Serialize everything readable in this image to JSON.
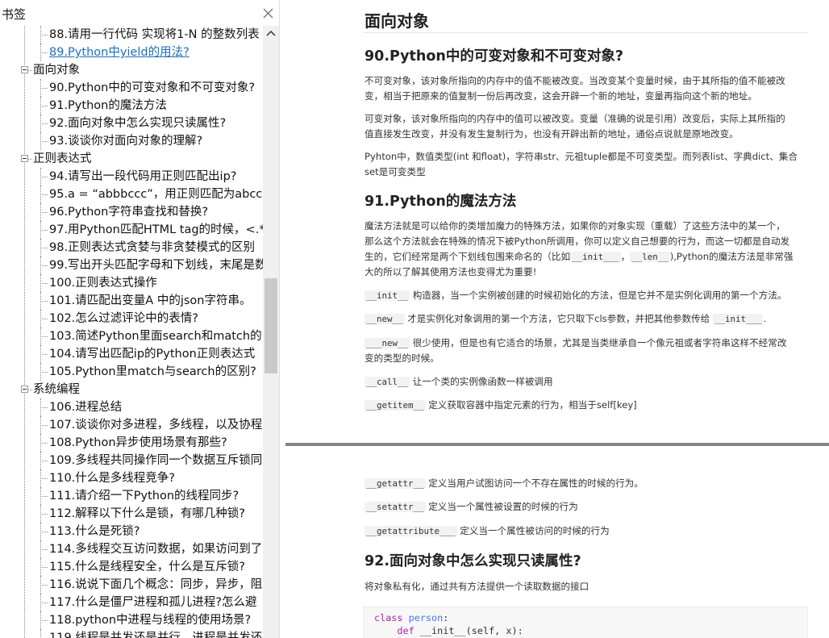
{
  "bookmarks": {
    "title": "书签",
    "items": [
      {
        "label": "88.请用一行代码 实现将1-N 的整数列表",
        "level": 1
      },
      {
        "label": "89.Python中yield的用法?",
        "level": 1,
        "link": true
      },
      {
        "label": "面向对象",
        "level": 0
      },
      {
        "label": "90.Python中的可变对象和不可变对象?",
        "level": 1
      },
      {
        "label": "91.Python的魔法方法",
        "level": 1
      },
      {
        "label": "92.面向对象中怎么实现只读属性?",
        "level": 1
      },
      {
        "label": "93.谈谈你对面向对象的理解?",
        "level": 1
      },
      {
        "label": "正则表达式",
        "level": 0
      },
      {
        "label": "94.请写出一段代码用正则匹配出ip?",
        "level": 1
      },
      {
        "label": "95.a = “abbbccc”，用正则匹配为abccc",
        "level": 1
      },
      {
        "label": "96.Python字符串查找和替换?",
        "level": 1
      },
      {
        "label": "97.用Python匹配HTML tag的时候，<.*>",
        "level": 1
      },
      {
        "label": "98.正则表达式贪婪与非贪婪模式的区别",
        "level": 1
      },
      {
        "label": "99.写出开头匹配字母和下划线，末尾是数",
        "level": 1
      },
      {
        "label": "100.正则表达式操作",
        "level": 1
      },
      {
        "label": "101.请匹配出变量A 中的json字符串。",
        "level": 1
      },
      {
        "label": "102.怎么过滤评论中的表情?",
        "level": 1
      },
      {
        "label": "103.简述Python里面search和match的区",
        "level": 1
      },
      {
        "label": "104.请写出匹配ip的Python正则表达式",
        "level": 1
      },
      {
        "label": "105.Python里match与search的区别?",
        "level": 1
      },
      {
        "label": "系统编程",
        "level": 0
      },
      {
        "label": "106.进程总结",
        "level": 1
      },
      {
        "label": "107.谈谈你对多进程，多线程，以及协程",
        "level": 1
      },
      {
        "label": "108.Python异步使用场景有那些?",
        "level": 1
      },
      {
        "label": "109.多线程共同操作同一个数据互斥锁同",
        "level": 1
      },
      {
        "label": "110.什么是多线程竞争?",
        "level": 1
      },
      {
        "label": "111.请介绍一下Python的线程同步?",
        "level": 1
      },
      {
        "label": "112.解释以下什么是锁，有哪几种锁?",
        "level": 1
      },
      {
        "label": "113.什么是死锁?",
        "level": 1
      },
      {
        "label": "114.多线程交互访问数据，如果访问到了",
        "level": 1
      },
      {
        "label": "115.什么是线程安全，什么是互斥锁?",
        "level": 1
      },
      {
        "label": "116.说说下面几个概念：同步，异步，阻",
        "level": 1
      },
      {
        "label": "117.什么是僵尸进程和孤儿进程?怎么避",
        "level": 1
      },
      {
        "label": "118.python中进程与线程的使用场景?",
        "level": 1
      },
      {
        "label": "119.线程是并发还是并行，进程是并发还",
        "level": 1
      }
    ]
  },
  "page1": {
    "heading": "面向对象",
    "s90": {
      "title": "90.Python中的可变对象和不可变对象?",
      "p1a": "不可变对象，该对象所指向的内存中的值不能被改变。当改变某个变量时候，由于其所指的值不能被改",
      "p1b": "变，相当于把原来的值复制一份后再改变，这会开辟一个新的地址，变量再指向这个新的地址。",
      "p2a": "可变对象，该对象所指向的内存中的值可以被改变。变量（准确的说是引用）改变后，实际上其所指的",
      "p2b": "值直接发生改变，并没有发生复制行为，也没有开辟出新的地址，通俗点说就是原地改变。",
      "p3a": "Pyhton中，数值类型(int 和float)，字符串str、元祖tuple都是不可变类型。而列表list、字典dict、集合",
      "p3b": "set是可变类型"
    },
    "s91": {
      "title": "91.Python的魔法方法",
      "p1a": "魔法方法就是可以给你的类增加魔力的特殊方法，如果你的对象实现（重载）了这些方法中的某一个，",
      "p1b": "那么这个方法就会在特殊的情况下被Python所调用，你可以定义自己想要的行为，而这一切都是自动发",
      "p1c_pre": "生的，它们经常是两个下划线包围来命名的（比如",
      "p1c_code1": "__init___",
      "p1c_sep": "，",
      "p1c_code2": "__len__",
      "p1c_post": "),Python的魔法方法是非常强",
      "p1d": "大的所以了解其使用方法也变得尤为重要!",
      "init_code": "__init__",
      "init_text": "构造器，当一个实例被创建的时候初始化的方法，但是它并不是实例化调用的第一个方法。",
      "new_code": "__new__",
      "new_text_pre": "才是实例化对象调用的第一个方法，它只取下cls参数，并把其他参数传给",
      "new_text_code": "__init___",
      "new_text_post": ".",
      "new2_code": "___new__",
      "new2_text_a": "很少使用，但是也有它适合的场景，尤其是当类继承自一个像元祖或者字符串这样不经常改",
      "new2_text_b": "变的类型的时候。",
      "call_code": "__call__",
      "call_text": "让一个类的实例像函数一样被调用",
      "getitem_code": "__getitem__",
      "getitem_text": "定义获取容器中指定元素的行为，相当于self[key]"
    }
  },
  "page2": {
    "getattr_code": "__getattr__",
    "getattr_text": "定义当用户试图访问一个不存在属性的时候的行为。",
    "setattr_code": "__setattr__",
    "setattr_text": "定义当一个属性被设置的时候的行为",
    "getattribute_code": "__getattribute___",
    "getattribute_text": "定义当一个属性被访问的时候的行为",
    "s92_title": "92.面向对象中怎么实现只读属性?",
    "s92_p": "将对象私有化，通过共有方法提供一个读取数据的接口",
    "code_kw1": "class",
    "code_cls": "person",
    "code_l1_end": ":",
    "code_l2_indent": "    ",
    "code_kw2": "def",
    "code_l2_rest": " __init__(self, x):"
  }
}
